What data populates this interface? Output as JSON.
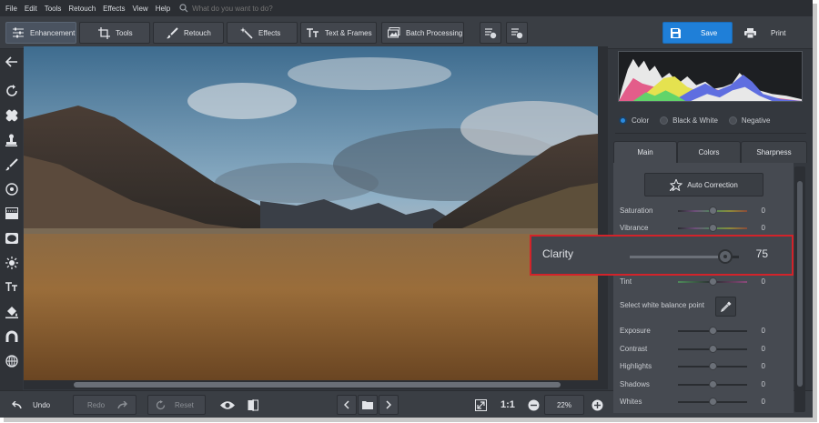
{
  "menu": {
    "items": [
      "File",
      "Edit",
      "Tools",
      "Retouch",
      "Effects",
      "View",
      "Help"
    ],
    "search_placeholder": "What do you want to do?"
  },
  "toolbar": {
    "tabs": [
      {
        "label": "Enhancement",
        "icon": "sliders-icon",
        "active": true
      },
      {
        "label": "Tools",
        "icon": "crop-icon",
        "active": false
      },
      {
        "label": "Retouch",
        "icon": "brush-icon",
        "active": false
      },
      {
        "label": "Effects",
        "icon": "magic-wand-icon",
        "active": false
      },
      {
        "label": "Text & Frames",
        "icon": "text-icon",
        "active": false
      },
      {
        "label": "Batch Processing",
        "icon": "batch-icon",
        "active": false
      }
    ],
    "save_label": "Save",
    "print_label": "Print",
    "accent_color": "#1f7fd8"
  },
  "left_tools": [
    "back-arrow-icon",
    "rotate-icon",
    "bandage-icon",
    "stamp-icon",
    "brush-icon",
    "radial-filter-icon",
    "gradient-filter-icon",
    "vignette-icon",
    "sun-icon",
    "text-icon",
    "fill-bucket-icon",
    "magnet-icon",
    "globe-icon"
  ],
  "bottom": {
    "undo_label": "Undo",
    "redo_label": "Redo",
    "reset_label": "Reset",
    "one_to_one": "1:1",
    "zoom": "22%"
  },
  "right_panel": {
    "modes": [
      {
        "label": "Color",
        "selected": true
      },
      {
        "label": "Black & White",
        "selected": false
      },
      {
        "label": "Negative",
        "selected": false
      }
    ],
    "tabs": [
      {
        "label": "Main",
        "active": true
      },
      {
        "label": "Colors",
        "active": false
      },
      {
        "label": "Sharpness",
        "active": false
      }
    ],
    "auto_correction_label": "Auto Correction",
    "sliders_top": [
      {
        "label": "Saturation",
        "value": "0",
        "level": 0.5
      },
      {
        "label": "Vibrance",
        "value": "0",
        "level": 0.5
      }
    ],
    "tint": {
      "label": "Tint",
      "value": "0",
      "level": 0.5
    },
    "white_balance_label": "Select white balance point",
    "sliders_bottom": [
      {
        "label": "Exposure",
        "value": "0",
        "level": 0.5
      },
      {
        "label": "Contrast",
        "value": "0",
        "level": 0.5
      },
      {
        "label": "Highlights",
        "value": "0",
        "level": 0.5
      },
      {
        "label": "Shadows",
        "value": "0",
        "level": 0.5
      },
      {
        "label": "Whites",
        "value": "0",
        "level": 0.5
      }
    ],
    "clarity": {
      "label": "Clarity",
      "value": "75",
      "level": 0.875
    },
    "highlight_color": "#d2232a"
  }
}
